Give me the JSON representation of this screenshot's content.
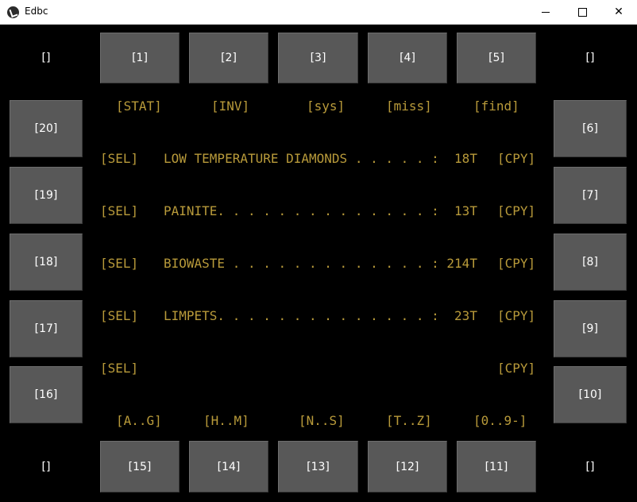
{
  "window": {
    "title": "Edbc",
    "minimize_label": "",
    "maximize_label": "",
    "close_label": "✕"
  },
  "colors": {
    "background": "#000000",
    "button": "#585858",
    "button_text": "#ffffff",
    "accent_text": "#b89a3a"
  },
  "corners": {
    "top_left": "[]",
    "top_right": "[]",
    "bottom_left": "[]",
    "bottom_right": "[]"
  },
  "top_buttons": [
    "[1]",
    "[2]",
    "[3]",
    "[4]",
    "[5]"
  ],
  "right_buttons": [
    "[6]",
    "[7]",
    "[8]",
    "[9]",
    "[10]"
  ],
  "bottom_buttons": [
    "[15]",
    "[14]",
    "[13]",
    "[12]",
    "[11]"
  ],
  "left_buttons": [
    "[20]",
    "[19]",
    "[18]",
    "[17]",
    "[16]"
  ],
  "top_tabs": [
    "[STAT]",
    "[INV]",
    "[sys]",
    "[miss]",
    "[find]"
  ],
  "bottom_tabs": [
    "[A..G]",
    "[H..M]",
    "[N..S]",
    "[T..Z]",
    "[0..9-]"
  ],
  "rows": [
    {
      "sel": "[SEL]",
      "text": "LOW TEMPERATURE DIAMONDS . . . . . :  18T",
      "copy": "[CPY]"
    },
    {
      "sel": "[SEL]",
      "text": "PAINITE. . . . . . . . . . . . . . :  13T",
      "copy": "[CPY]"
    },
    {
      "sel": "[SEL]",
      "text": "BIOWASTE . . . . . . . . . . . . . : 214T",
      "copy": "[CPY]"
    },
    {
      "sel": "[SEL]",
      "text": "LIMPETS. . . . . . . . . . . . . . :  23T",
      "copy": "[CPY]"
    },
    {
      "sel": "[SEL]",
      "text": "",
      "copy": "[CPY]"
    }
  ]
}
